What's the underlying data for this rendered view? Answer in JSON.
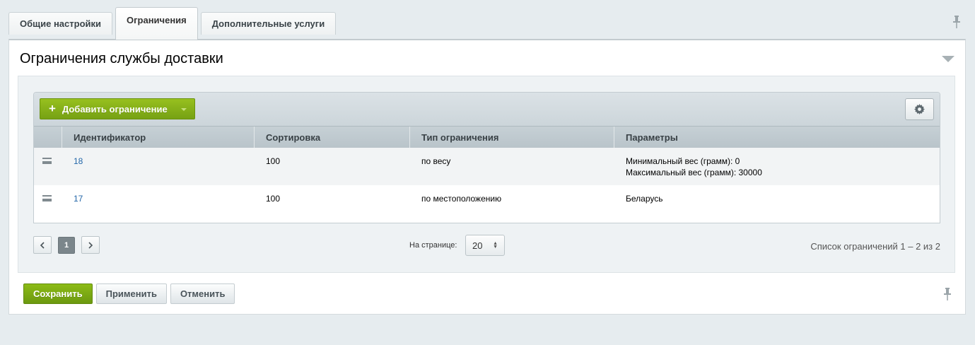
{
  "tabs": [
    {
      "label": "Общие настройки"
    },
    {
      "label": "Ограничения"
    },
    {
      "label": "Дополнительные услуги"
    }
  ],
  "section": {
    "title": "Ограничения службы доставки"
  },
  "grid": {
    "add_button_label": "Добавить ограничение",
    "columns": [
      "Идентификатор",
      "Сортировка",
      "Тип ограничения",
      "Параметры"
    ],
    "rows": [
      {
        "id": "18",
        "sort": "100",
        "type": "по весу",
        "params_line1": "Минимальный вес (грамм): 0",
        "params_line2": "Максимальный вес (грамм): 30000"
      },
      {
        "id": "17",
        "sort": "100",
        "type": "по местоположению",
        "params_line1": "Беларусь",
        "params_line2": ""
      }
    ]
  },
  "pager": {
    "current_page": "1",
    "per_page_label": "На странице:",
    "per_page_value": "20",
    "total_text": "Список ограничений 1 – 2 из 2"
  },
  "footer": {
    "save_label": "Сохранить",
    "apply_label": "Применить",
    "cancel_label": "Отменить"
  },
  "icons": {
    "pin": "pin-icon",
    "collapse": "collapse-triangle-icon",
    "settings": "gear-icon",
    "drag": "drag-handle-icon"
  },
  "colors": {
    "accent_green": "#7aa613",
    "link_blue": "#2467a9"
  }
}
